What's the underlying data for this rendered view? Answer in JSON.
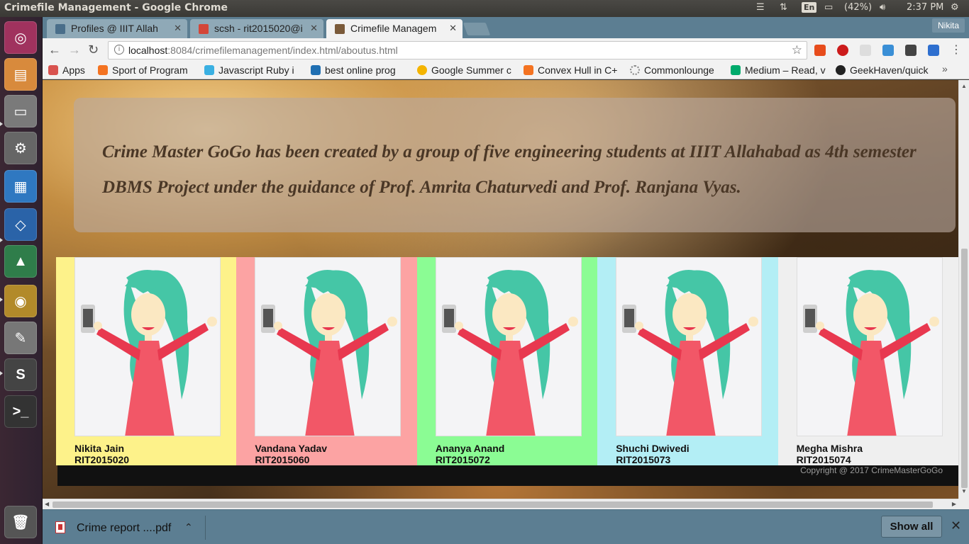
{
  "window": {
    "title": "Crimefile Management - Google Chrome"
  },
  "indicators": {
    "keyboard": "En",
    "battery": "(42%)",
    "time": "2:37 PM"
  },
  "profile": {
    "name": "Nikita"
  },
  "tabs": [
    {
      "label": "Profiles @ IIIT Allah",
      "favicon_color": "#4a6e8a",
      "icon": "document-icon"
    },
    {
      "label": "scsh - rit2015020@i",
      "favicon_color": "#d44638",
      "icon": "gmail-icon"
    },
    {
      "label": "Crimefile Managem",
      "favicon_color": "#7a5a3a",
      "icon": "page-icon"
    }
  ],
  "address": {
    "host": "localhost",
    "path": ":8084/crimefilemanagement/index.html/aboutus.html"
  },
  "bookmarks": [
    {
      "label": "Apps",
      "color": "#d9534f",
      "icon": "apps-grid-icon"
    },
    {
      "label": "Sport of Program",
      "color": "#f47321",
      "icon": "blogger-icon"
    },
    {
      "label": "Javascript Ruby i",
      "color": "#3ab0e2",
      "icon": "lightning-icon"
    },
    {
      "label": "best online prog",
      "color": "#1f6fb2",
      "icon": "hackerrank-icon"
    },
    {
      "label": "Google Summer c",
      "color": "#f4b400",
      "icon": "gsoc-icon"
    },
    {
      "label": "Convex Hull in C+",
      "color": "#f47321",
      "icon": "blogger-icon"
    },
    {
      "label": "Commonlounge",
      "color": "#888888",
      "icon": "loading-icon"
    },
    {
      "label": "Medium – Read, v",
      "color": "#00ab6c",
      "icon": "medium-icon"
    },
    {
      "label": "GeekHaven/quick",
      "color": "#222222",
      "icon": "github-icon"
    }
  ],
  "about": {
    "text": "Crime Master GoGo has been created by a group of five engineering students at IIIT Allahabad as 4th semester DBMS Project under the guidance of Prof. Amrita Chaturvedi and Prof. Ranjana Vyas."
  },
  "team": [
    {
      "name": "Nikita Jain",
      "roll": "RIT2015020",
      "bg": "#fdf28a"
    },
    {
      "name": "Vandana Yadav",
      "roll": "RIT2015060",
      "bg": "#fca3a3"
    },
    {
      "name": "Ananya Anand",
      "roll": "RIT2015072",
      "bg": "#8bfc94"
    },
    {
      "name": "Shuchi Dwivedi",
      "roll": "RIT2015073",
      "bg": "#b3eef5"
    },
    {
      "name": "Megha Mishra",
      "roll": "RIT2015074",
      "bg": "#efefef"
    }
  ],
  "footer": {
    "copyright": "Copyright @ 2017 CrimeMasterGoGo"
  },
  "downloads": {
    "file": "Crime report ....pdf",
    "show_all": "Show all"
  }
}
